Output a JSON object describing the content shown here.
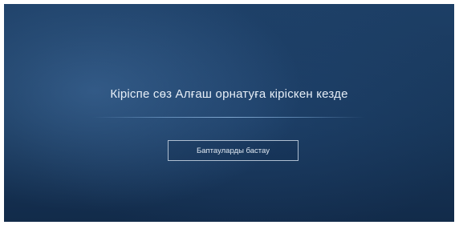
{
  "welcome": {
    "title": "Кіріспе сөз Алғаш орнатуға кірiскен кезде",
    "start_button_label": "Баптауларды бастау"
  },
  "colors": {
    "background_top": "#1d3f66",
    "background_bottom": "#122b4a",
    "text": "#e6eef7",
    "button_border": "#aebed0"
  }
}
